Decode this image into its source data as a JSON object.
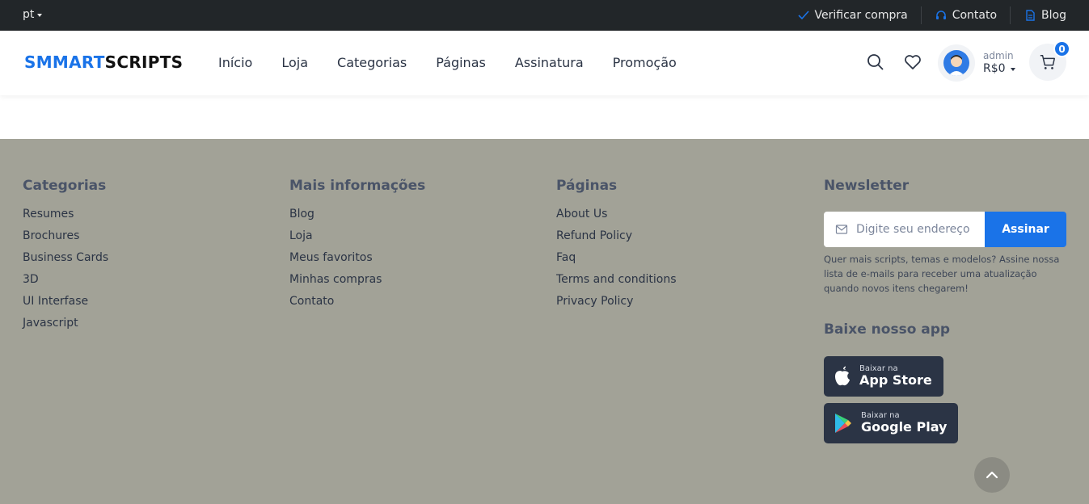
{
  "topbar": {
    "language": "pt",
    "links": [
      {
        "label": "Verificar compra",
        "icon": "check-icon"
      },
      {
        "label": "Contato",
        "icon": "headset-icon"
      },
      {
        "label": "Blog",
        "icon": "document-icon"
      }
    ]
  },
  "header": {
    "logo_part1": "SMMART",
    "logo_part2": "SCRIPTS",
    "nav": [
      "Início",
      "Loja",
      "Categorias",
      "Páginas",
      "Assinatura",
      "Promoção"
    ],
    "user": {
      "name": "admin",
      "balance": "R$0"
    },
    "cart_count": "0"
  },
  "footer": {
    "categories": {
      "title": "Categorias",
      "items": [
        "Resumes",
        "Brochures",
        "Business Cards",
        "3D",
        "UI Interfase",
        "Javascript"
      ]
    },
    "more_info": {
      "title": "Mais informações",
      "items": [
        "Blog",
        "Loja",
        "Meus favoritos",
        "Minhas compras",
        "Contato"
      ]
    },
    "pages": {
      "title": "Páginas",
      "items": [
        "About Us",
        "Refund Policy",
        "Faq",
        "Terms and conditions",
        "Privacy Policy"
      ]
    },
    "newsletter": {
      "title": "Newsletter",
      "placeholder": "Digite seu endereço de e-mail",
      "button": "Assinar",
      "description": "Quer mais scripts, temas e modelos? Assine nossa lista de e-mails para receber uma atualização quando novos itens chegarem!"
    },
    "app": {
      "title": "Baixe nosso app",
      "app_store": {
        "small": "Baixar na",
        "big": "App Store"
      },
      "google_play": {
        "small": "Baixar na",
        "big": "Google Play"
      }
    }
  },
  "colors": {
    "accent": "#1a73e8",
    "topbar_bg": "#222629",
    "footer_bg": "#a2a297",
    "store_button_bg": "#2b3445"
  }
}
